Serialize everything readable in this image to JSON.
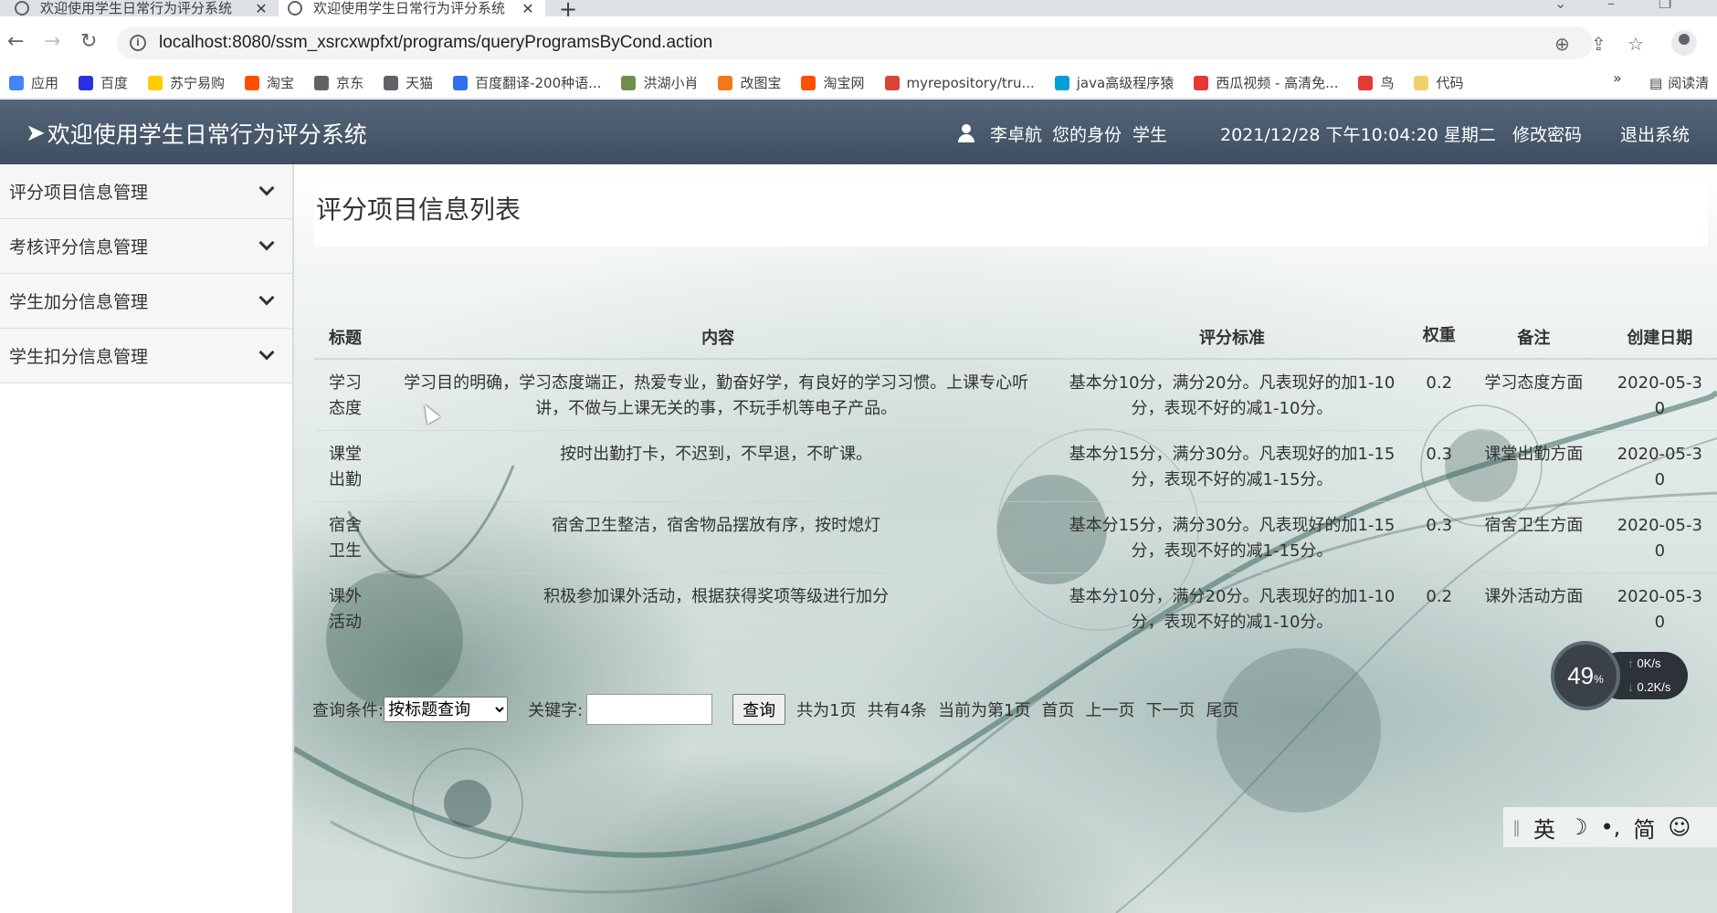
{
  "browser": {
    "tabs": [
      {
        "title": "欢迎使用学生日常行为评分系统",
        "active": false
      },
      {
        "title": "欢迎使用学生日常行为评分系统",
        "active": true
      }
    ],
    "new_tab": "+",
    "address": "localhost:8080/ssm_xsrcxwpfxt/programs/queryProgramsByCond.action",
    "bookmarks": [
      {
        "label": "应用",
        "color": "#4285f4"
      },
      {
        "label": "百度",
        "color": "#2932e1"
      },
      {
        "label": "苏宁易购",
        "color": "#ffcc00"
      },
      {
        "label": "淘宝",
        "color": "#ff5000"
      },
      {
        "label": "京东",
        "color": "#5f6368"
      },
      {
        "label": "天猫",
        "color": "#5f6368"
      },
      {
        "label": "百度翻译-200种语...",
        "color": "#2f6fea"
      },
      {
        "label": "洪湖小肖",
        "color": "#6d8f4e"
      },
      {
        "label": "改图宝",
        "color": "#f07a1a"
      },
      {
        "label": "淘宝网",
        "color": "#ff5000"
      },
      {
        "label": "myrepository/tru...",
        "color": "#db4437"
      },
      {
        "label": "java高级程序猿",
        "color": "#00a1d6"
      },
      {
        "label": "西瓜视频 - 高清免...",
        "color": "#e53935"
      },
      {
        "label": "鸟",
        "color": "#e53935"
      },
      {
        "label": "代码",
        "color": "#f2d16b"
      }
    ],
    "bookmarks_more": "»",
    "reading_list": "阅读清"
  },
  "header": {
    "app_title": "欢迎使用学生日常行为评分系统",
    "user_name": "李卓航",
    "role_label": "您的身份",
    "role": "学生",
    "datetime": "2021/12/28 下午10:04:20 星期二",
    "change_password": "修改密码",
    "logout": "退出系统"
  },
  "sidebar": {
    "items": [
      {
        "label": "评分项目信息管理"
      },
      {
        "label": "考核评分信息管理"
      },
      {
        "label": "学生加分信息管理"
      },
      {
        "label": "学生扣分信息管理"
      }
    ]
  },
  "main": {
    "page_title": "评分项目信息列表",
    "table": {
      "headers": [
        "标题",
        "内容",
        "评分标准",
        "权重",
        "备注",
        "创建日期"
      ],
      "rows": [
        [
          "学习态度",
          "学习目的明确，学习态度端正，热爱专业，勤奋好学，有良好的学习习惯。上课专心听讲，不做与上课无关的事，不玩手机等电子产品。",
          "基本分10分，满分20分。凡表现好的加1-10分，表现不好的减1-10分。",
          "0.2",
          "学习态度方面",
          "2020-05-30"
        ],
        [
          "课堂出勤",
          "按时出勤打卡，不迟到，不早退，不旷课。",
          "基本分15分，满分30分。凡表现好的加1-15分，表现不好的减1-15分。",
          "0.3",
          "课堂出勤方面",
          "2020-05-30"
        ],
        [
          "宿舍卫生",
          "宿舍卫生整洁，宿舍物品摆放有序，按时熄灯",
          "基本分15分，满分30分。凡表现好的加1-15分，表现不好的减1-15分。",
          "0.3",
          "宿舍卫生方面",
          "2020-05-30"
        ],
        [
          "课外活动",
          "积极参加课外活动，根据获得奖项等级进行加分",
          "基本分10分，满分20分。凡表现好的加1-10分，表现不好的减1-10分。",
          "0.2",
          "课外活动方面",
          "2020-05-30"
        ]
      ]
    },
    "search": {
      "condition_label": "查询条件:",
      "condition_selected": "按标题查询",
      "keyword_label": "关键字:",
      "keyword_value": "",
      "query_button": "查询",
      "total_pages": "共为1页",
      "total_records": "共有4条",
      "current_page": "当前为第1页",
      "first": "首页",
      "prev": "上一页",
      "next": "下一页",
      "last": "尾页"
    }
  },
  "overlay": {
    "cpu_value": "49",
    "cpu_unit": "%",
    "upload": "0K/s",
    "download": "0.2K/s",
    "ime": [
      "英",
      "☽",
      "•,",
      "简",
      "☺"
    ]
  }
}
